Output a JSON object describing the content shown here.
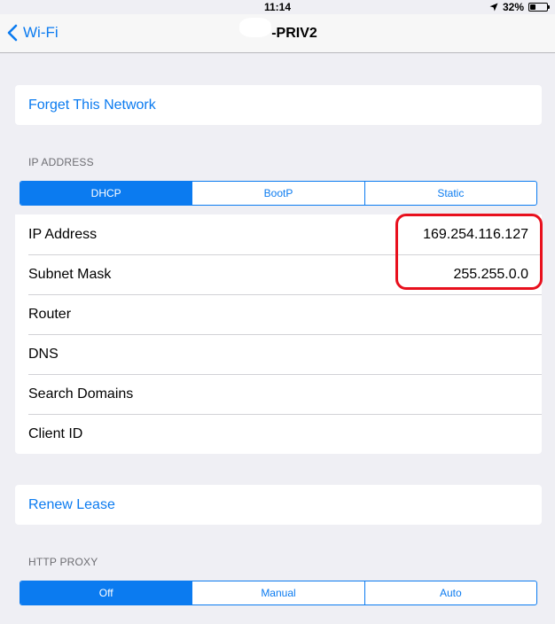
{
  "status_bar": {
    "time": "11:14",
    "battery_percent": "32%",
    "battery_level": 0.32,
    "icons": [
      "location-arrow-icon",
      "battery-icon"
    ]
  },
  "nav": {
    "back_label": "Wi-Fi",
    "title": "-PRIV2"
  },
  "forget_network": {
    "label": "Forget This Network"
  },
  "ip_address_section": {
    "header": "IP ADDRESS",
    "segments": [
      "DHCP",
      "BootP",
      "Static"
    ],
    "selected": "DHCP",
    "rows": [
      {
        "label": "IP Address",
        "value": "169.254.116.127"
      },
      {
        "label": "Subnet Mask",
        "value": "255.255.0.0"
      },
      {
        "label": "Router",
        "value": ""
      },
      {
        "label": "DNS",
        "value": ""
      },
      {
        "label": "Search Domains",
        "value": ""
      },
      {
        "label": "Client ID",
        "value": ""
      }
    ]
  },
  "renew_lease": {
    "label": "Renew Lease"
  },
  "http_proxy_section": {
    "header": "HTTP PROXY",
    "segments": [
      "Off",
      "Manual",
      "Auto"
    ],
    "selected": "Off"
  },
  "colors": {
    "accent": "#0b7bf0",
    "background": "#efeff4",
    "highlight": "#e8101d"
  }
}
